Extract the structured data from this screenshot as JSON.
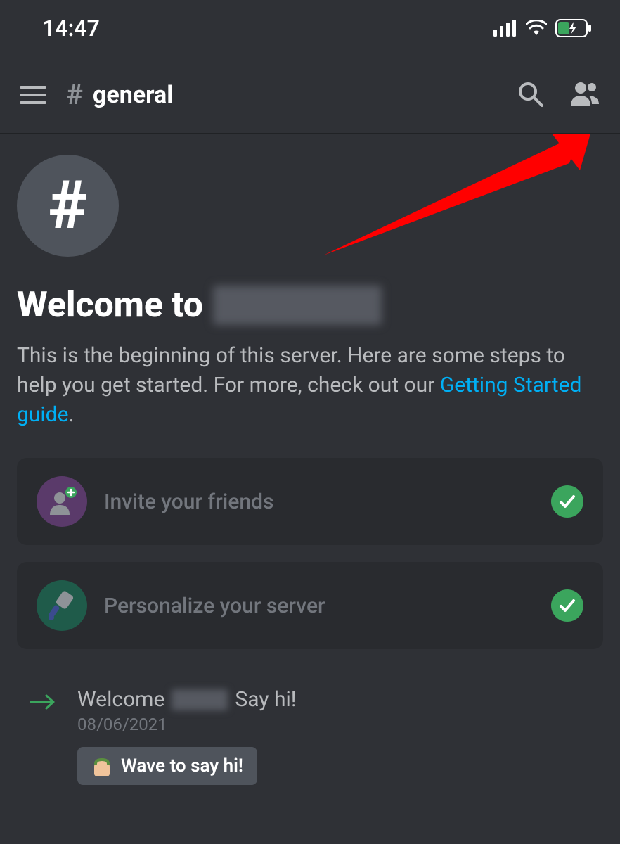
{
  "status": {
    "time": "14:47"
  },
  "header": {
    "channel_hash": "#",
    "channel_name": "general"
  },
  "welcome": {
    "badge_hash": "#",
    "title_prefix": "Welcome to",
    "description_before_link": "This is the beginning of this server. Here are some steps to help you get started. For more, check out our ",
    "link_text": "Getting Started guide",
    "description_after_link": "."
  },
  "steps": [
    {
      "label": "Invite your friends",
      "icon": "invite-icon",
      "done": true
    },
    {
      "label": "Personalize your server",
      "icon": "personalize-icon",
      "done": true
    }
  ],
  "system_message": {
    "line_prefix": "Welcome",
    "line_suffix": "Say hi!",
    "date": "08/06/2021",
    "wave_label": "Wave to say hi!"
  }
}
